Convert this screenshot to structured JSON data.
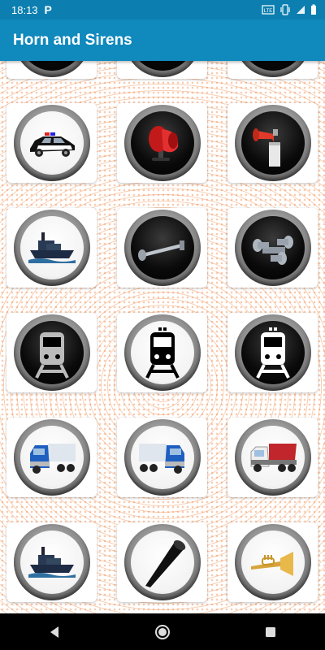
{
  "status_bar": {
    "time": "18:13",
    "notification_icon": "p-icon",
    "icons": [
      "volte-icon",
      "vibrate-icon",
      "signal-icon",
      "battery-icon"
    ],
    "background": "#0c7fb0"
  },
  "app_bar": {
    "title": "Horn and Sirens",
    "background": "#1089bd"
  },
  "grid": [
    {
      "name": "partial-top-1",
      "face": "black"
    },
    {
      "name": "partial-top-2",
      "face": "black"
    },
    {
      "name": "partial-top-3",
      "face": "black"
    },
    {
      "name": "police-car",
      "face": "white",
      "icon": "police-car-icon"
    },
    {
      "name": "red-horn",
      "face": "black",
      "icon": "red-horn-icon"
    },
    {
      "name": "air-horn-can",
      "face": "black",
      "icon": "air-horn-can-icon"
    },
    {
      "name": "tugboat",
      "face": "white",
      "icon": "tugboat-icon"
    },
    {
      "name": "train-horn-single",
      "face": "black",
      "icon": "train-horn-icon"
    },
    {
      "name": "train-horn-triple",
      "face": "black",
      "icon": "triple-horn-icon"
    },
    {
      "name": "train-grey",
      "face": "black",
      "icon": "train-icon"
    },
    {
      "name": "train-black",
      "face": "white",
      "icon": "train-icon"
    },
    {
      "name": "train-white",
      "face": "black",
      "icon": "train-icon"
    },
    {
      "name": "blue-truck-1",
      "face": "white",
      "icon": "blue-truck-icon"
    },
    {
      "name": "blue-truck-2",
      "face": "white",
      "icon": "blue-truck-icon"
    },
    {
      "name": "dump-truck",
      "face": "white",
      "icon": "dump-truck-icon"
    },
    {
      "name": "tugboat-2",
      "face": "white",
      "icon": "tugboat-icon"
    },
    {
      "name": "vuvuzela",
      "face": "white",
      "icon": "vuvuzela-icon"
    },
    {
      "name": "trumpet",
      "face": "white",
      "icon": "trumpet-icon"
    }
  ],
  "nav_bar": {
    "icons": [
      "back-icon",
      "home-icon",
      "recents-icon"
    ]
  }
}
